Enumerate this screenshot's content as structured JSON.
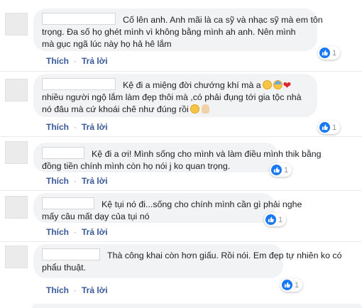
{
  "comments": [
    {
      "lines": [
        "Cố lên anh. Anh mãi là ca sỹ và nhạc sỹ mà em tôn",
        "trọng. Đa số họ ghét mình vì không bằng mình ah anh. Nên mình",
        "mà gục ngã lúc này họ hả hê lắm"
      ],
      "likes": "1",
      "like_label": "Thích",
      "reply_label": "Trả lời",
      "separator": "·"
    },
    {
      "lines": [
        "Kệ đi a miệng đời chướng khí mà a",
        "nhiều người ngộ lắm làm đẹp thôi mà ,có phải đụng tới gia tộc nhà",
        "nó đâu mà cứ khoái chê như đúng rồi"
      ],
      "likes": "1",
      "like_label": "Thích",
      "reply_label": "Trả lời",
      "separator": "·"
    },
    {
      "lines": [
        "Kệ đi a ơi! Mình sống cho mình và làm điều mình thik bằng",
        "đồng tiền chính mình còn họ nói j ko quan trọng."
      ],
      "likes": "1",
      "like_label": "Thích",
      "reply_label": "Trả lời",
      "separator": "·"
    },
    {
      "lines": [
        "Kệ tụi nó đi...sống cho chính mình cần gì phải nghe",
        "mấy câu mất dạy của tụi nó"
      ],
      "likes": "1",
      "like_label": "Thích",
      "reply_label": "Trả lời",
      "separator": "·"
    },
    {
      "lines": [
        "Thà công khai còn hơn giấu. Rồi nói. Em đẹp tự nhiên ko có",
        "phẩu thuật."
      ],
      "likes": "1",
      "like_label": "Thích",
      "reply_label": "Trả lời",
      "separator": "·"
    }
  ],
  "icons": {
    "like": "thumbs-up-icon",
    "emoji_1": "face-rolling-eyes-icon",
    "emoji_2": "face-cold-sweat-icon",
    "emoji_3": "red-heart-icon",
    "emoji_4": "face-unamused-icon",
    "emoji_5": "ok-hand-icon"
  },
  "colors": {
    "bubble": "#f2f3f5",
    "link": "#385898",
    "like_blue": "#1877f2",
    "muted": "#90949c"
  }
}
